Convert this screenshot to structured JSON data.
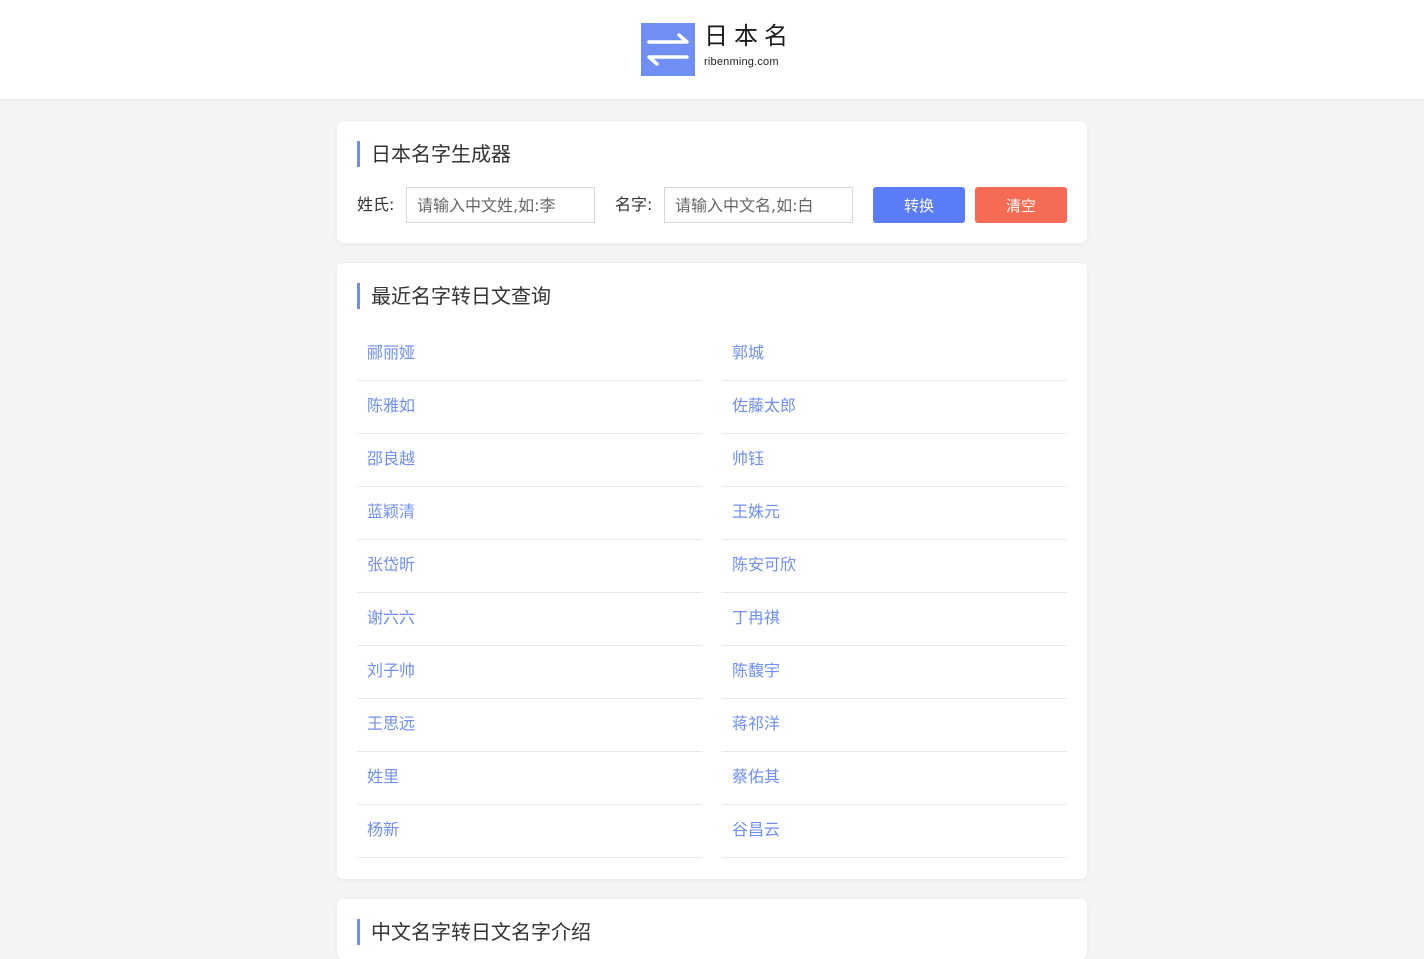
{
  "header": {
    "logo_title": "日本名",
    "logo_sub": "ribenming.com",
    "logo_icon": "swap-arrows-icon",
    "accent": "#6f8ff5"
  },
  "generator": {
    "title": "日本名字生成器",
    "surname_label": "姓氏:",
    "surname_placeholder": "请输入中文姓,如:李",
    "name_label": "名字:",
    "name_placeholder": "请输入中文名,如:白",
    "convert_label": "转换",
    "convert_color": "#5b7cf7",
    "clear_label": "清空",
    "clear_color": "#f56b54"
  },
  "recent": {
    "title": "最近名字转日文查询",
    "items": [
      "郦丽娅",
      "郭城",
      "陈雅如",
      "佐藤太郎",
      "邵良越",
      "帅钰",
      "蓝颖清",
      "王姝元",
      "张岱昕",
      "陈安可欣",
      "谢六六",
      "丁冉祺",
      "刘子帅",
      "陈馥宇",
      "王思远",
      "蒋祁洋",
      "姓里",
      "蔡佑其",
      "杨新",
      "谷昌云"
    ]
  },
  "intro": {
    "title": "中文名字转日文名字介绍"
  }
}
